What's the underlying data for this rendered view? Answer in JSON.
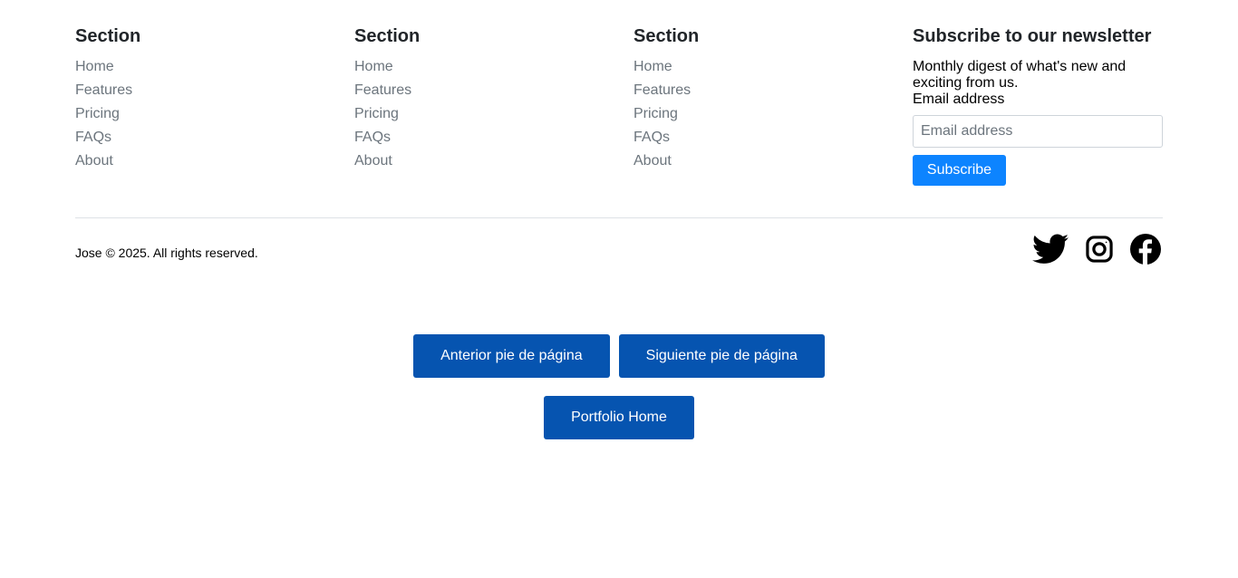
{
  "footer": {
    "columns": [
      {
        "title": "Section",
        "links": [
          "Home",
          "Features",
          "Pricing",
          "FAQs",
          "About"
        ]
      },
      {
        "title": "Section",
        "links": [
          "Home",
          "Features",
          "Pricing",
          "FAQs",
          "About"
        ]
      },
      {
        "title": "Section",
        "links": [
          "Home",
          "Features",
          "Pricing",
          "FAQs",
          "About"
        ]
      }
    ],
    "newsletter": {
      "title": "Subscribe to our newsletter",
      "description": "Monthly digest of what's new and exciting from us.",
      "email_label": "Email address",
      "email_placeholder": "Email address",
      "email_value": "",
      "subscribe_label": "Subscribe"
    },
    "copyright": "Jose © 2025. All rights reserved.",
    "socials": [
      "twitter-icon",
      "instagram-icon",
      "facebook-icon"
    ]
  },
  "navigation": {
    "prev_label": "Anterior pie de página",
    "next_label": "Siguiente pie de página",
    "home_label": "Portfolio Home"
  },
  "colors": {
    "link": "#6c757d",
    "subscribe": "#0d84ff",
    "nav_button": "#0654b0",
    "divider": "#dee2e6"
  }
}
